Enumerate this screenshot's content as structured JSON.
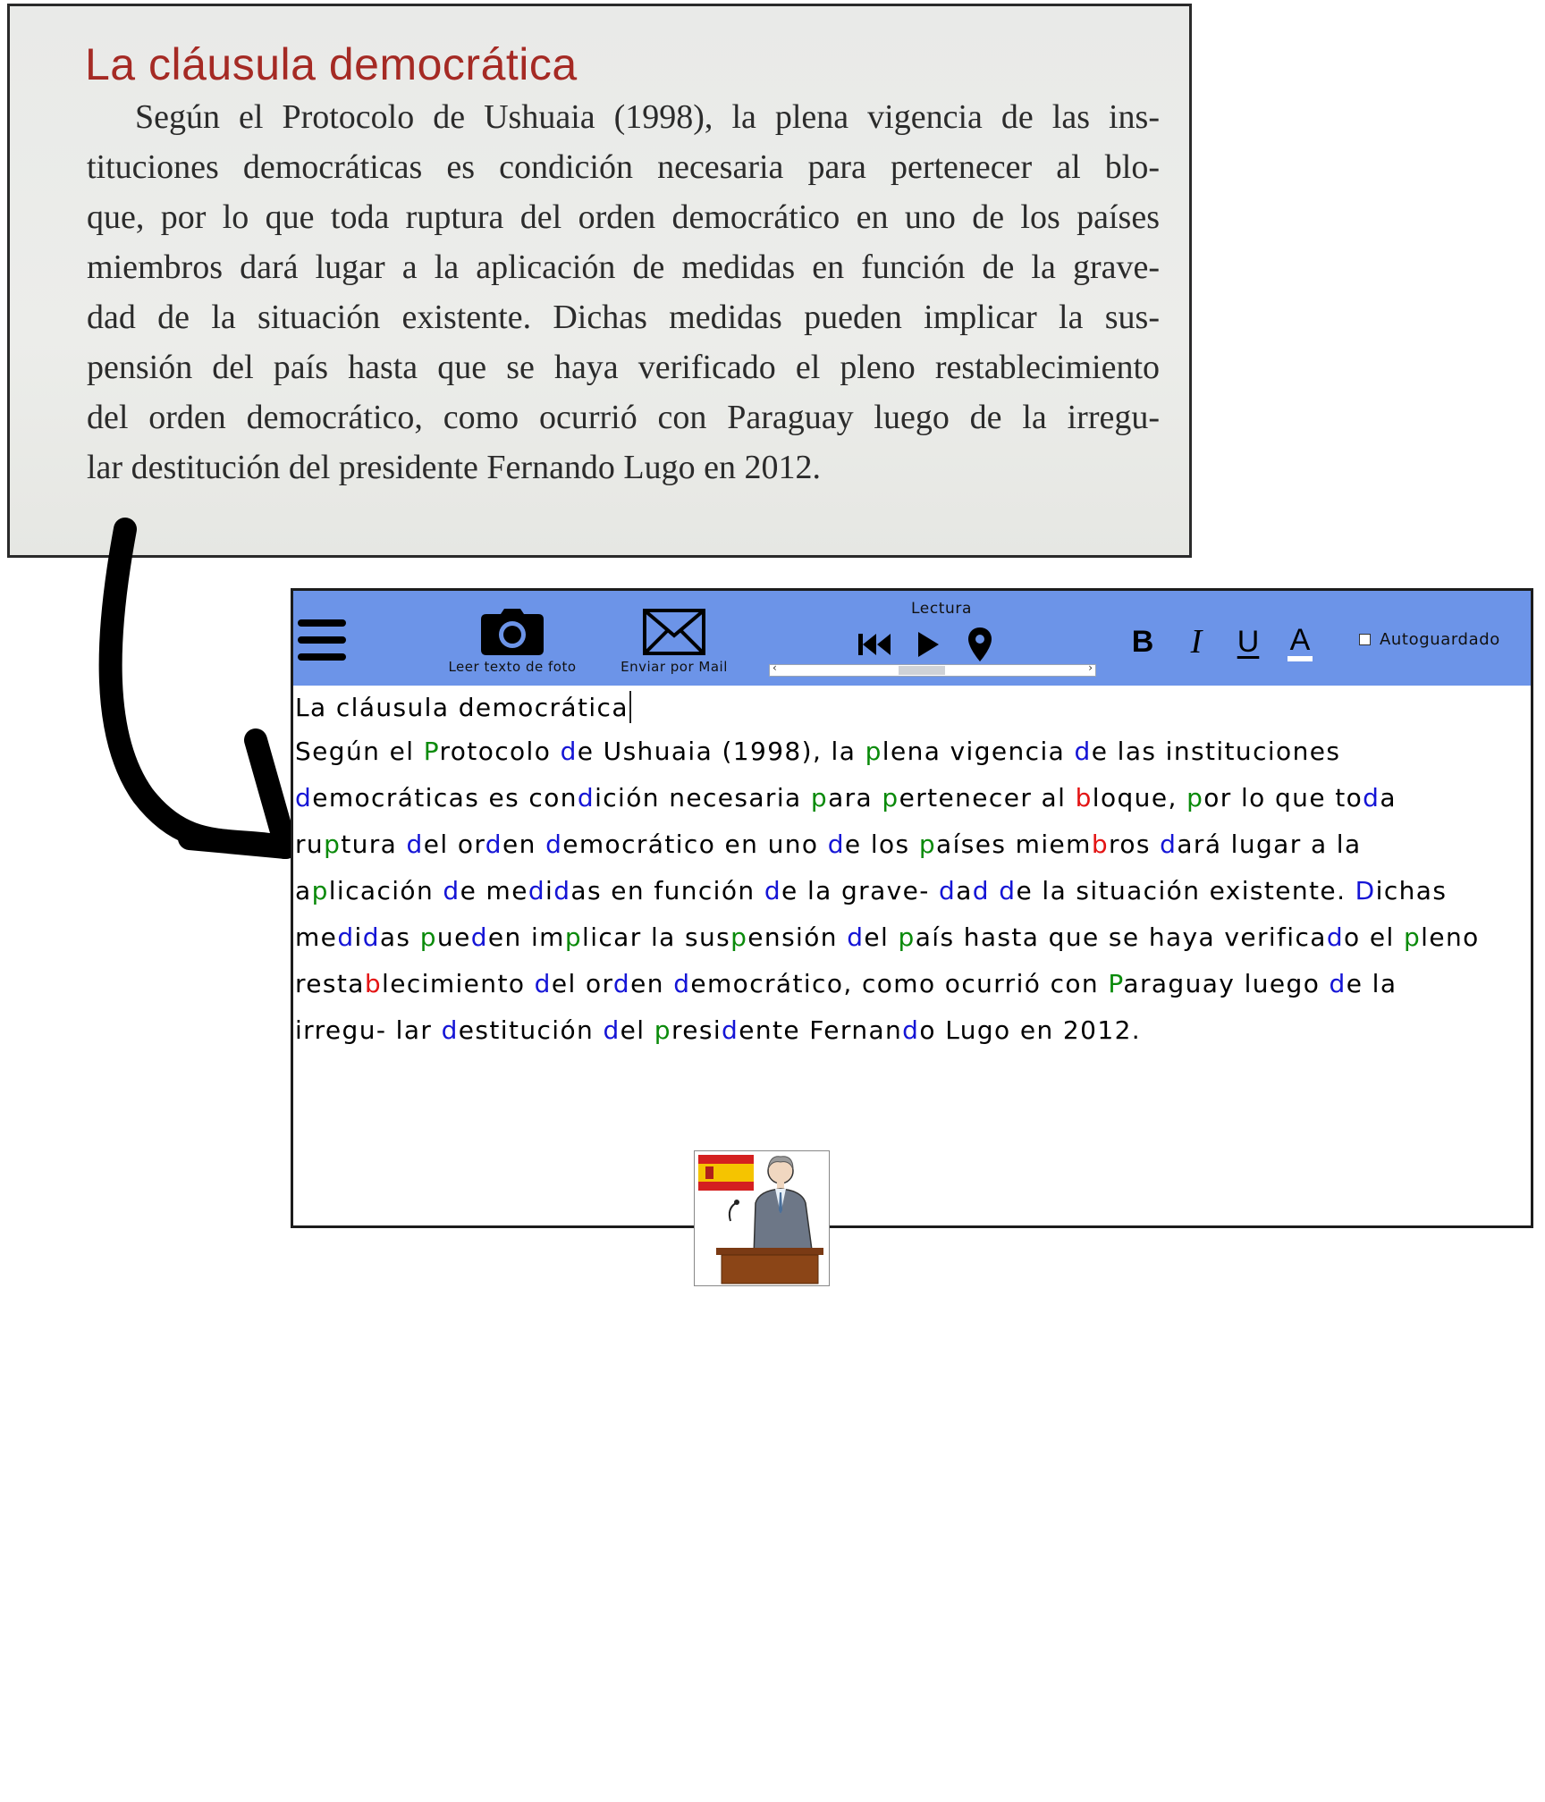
{
  "photo": {
    "title": "La cláusula democrática",
    "lines": [
      "Según el Protocolo de Ushuaia (1998), la plena vigencia de las ins-",
      "tituciones democráticas es condición necesaria para pertenecer al blo-",
      "que, por lo que toda ruptura del orden democrático en uno de los países",
      "miembros dará lugar a la aplicación de medidas en función de la grave-",
      "dad de la situación existente. Dichas medidas pueden implicar la sus-",
      "pensión del país hasta que se haya verificado el pleno restablecimiento",
      "del orden democrático, como ocurrió con Paraguay luego de la irregu-",
      "lar destitución del presidente Fernando Lugo en 2012."
    ]
  },
  "toolbar": {
    "menu_icon": "hamburger-menu-icon",
    "camera_icon": "camera-icon",
    "camera_label": "Leer texto de foto",
    "mail_icon": "envelope-icon",
    "mail_label": "Enviar por Mail",
    "reading_label": "Lectura",
    "rewind_icon": "skip-back-icon",
    "play_icon": "play-icon",
    "pin_icon": "map-pin-icon",
    "bold_label": "B",
    "italic_label": "I",
    "underline_label": "U",
    "font_color_label": "A",
    "autosave_label": "Autoguardado",
    "autosave_checked": false,
    "scroll_left": "‹",
    "scroll_right": "›",
    "background_color": "#6c94e8"
  },
  "editor": {
    "title": "La cláusula democrática",
    "color_codes": {
      "green": "#0a8a0a",
      "blue": "#1515d6",
      "red": "#e31414"
    },
    "lines": [
      [
        [
          "Según el ",
          ""
        ],
        [
          "P",
          "g"
        ],
        [
          "rotocolo ",
          ""
        ],
        [
          "d",
          "bl"
        ],
        [
          "e Ushuaia (1998), la ",
          ""
        ],
        [
          "p",
          "g"
        ],
        [
          "lena vigencia ",
          ""
        ],
        [
          "d",
          "bl"
        ],
        [
          "e las instituciones",
          ""
        ]
      ],
      [
        [
          "d",
          "bl"
        ],
        [
          "emocráticas es con",
          ""
        ],
        [
          "d",
          "bl"
        ],
        [
          "ición necesaria ",
          ""
        ],
        [
          "p",
          "g"
        ],
        [
          "ara ",
          ""
        ],
        [
          "p",
          "g"
        ],
        [
          "ertenecer al ",
          ""
        ],
        [
          "b",
          "r"
        ],
        [
          "loque, ",
          ""
        ],
        [
          "p",
          "g"
        ],
        [
          "or lo que to",
          ""
        ],
        [
          "d",
          "bl"
        ],
        [
          "a",
          ""
        ]
      ],
      [
        [
          "ru",
          ""
        ],
        [
          "p",
          "g"
        ],
        [
          "tura ",
          ""
        ],
        [
          "d",
          "bl"
        ],
        [
          "el or",
          ""
        ],
        [
          "d",
          "bl"
        ],
        [
          "en ",
          ""
        ],
        [
          "d",
          "bl"
        ],
        [
          "emocrático en uno ",
          ""
        ],
        [
          "d",
          "bl"
        ],
        [
          "e los ",
          ""
        ],
        [
          "p",
          "g"
        ],
        [
          "aíses miem",
          ""
        ],
        [
          "b",
          "r"
        ],
        [
          "ros ",
          ""
        ],
        [
          "d",
          "bl"
        ],
        [
          "ará lugar a la",
          ""
        ]
      ],
      [
        [
          "a",
          ""
        ],
        [
          "p",
          "g"
        ],
        [
          "licación ",
          ""
        ],
        [
          "d",
          "bl"
        ],
        [
          "e me",
          ""
        ],
        [
          "d",
          "bl"
        ],
        [
          "i",
          ""
        ],
        [
          "d",
          "bl"
        ],
        [
          "as en función ",
          ""
        ],
        [
          "d",
          "bl"
        ],
        [
          "e la grave- ",
          ""
        ],
        [
          "d",
          "bl"
        ],
        [
          "a",
          ""
        ],
        [
          "d",
          "bl"
        ],
        [
          " ",
          ""
        ],
        [
          "d",
          "bl"
        ],
        [
          "e la situación existente. ",
          ""
        ],
        [
          "D",
          "bl"
        ],
        [
          "ichas",
          ""
        ]
      ],
      [
        [
          "me",
          ""
        ],
        [
          "d",
          "bl"
        ],
        [
          "i",
          ""
        ],
        [
          "d",
          "bl"
        ],
        [
          "as ",
          ""
        ],
        [
          "p",
          "g"
        ],
        [
          "ue",
          ""
        ],
        [
          "d",
          "bl"
        ],
        [
          "en im",
          ""
        ],
        [
          "p",
          "g"
        ],
        [
          "licar la sus",
          ""
        ],
        [
          "p",
          "g"
        ],
        [
          "ensión ",
          ""
        ],
        [
          "d",
          "bl"
        ],
        [
          "el ",
          ""
        ],
        [
          "p",
          "g"
        ],
        [
          "aís hasta que se haya verifica",
          ""
        ],
        [
          "d",
          "bl"
        ],
        [
          "o el ",
          ""
        ],
        [
          "p",
          "g"
        ],
        [
          "leno",
          ""
        ]
      ],
      [
        [
          "resta",
          ""
        ],
        [
          "b",
          "r"
        ],
        [
          "lecimiento ",
          ""
        ],
        [
          "d",
          "bl"
        ],
        [
          "el or",
          ""
        ],
        [
          "d",
          "bl"
        ],
        [
          "en ",
          ""
        ],
        [
          "d",
          "bl"
        ],
        [
          "emocrático, como ocurrió con ",
          ""
        ],
        [
          "P",
          "g"
        ],
        [
          "araguay luego ",
          ""
        ],
        [
          "d",
          "bl"
        ],
        [
          "e la",
          ""
        ]
      ],
      [
        [
          "irregu- lar ",
          ""
        ],
        [
          "d",
          "bl"
        ],
        [
          "estitución ",
          ""
        ],
        [
          "d",
          "bl"
        ],
        [
          "el ",
          ""
        ],
        [
          "p",
          "g"
        ],
        [
          "resi",
          ""
        ],
        [
          "d",
          "bl"
        ],
        [
          "ente Fernan",
          ""
        ],
        [
          "d",
          "bl"
        ],
        [
          "o Lugo en 2012.",
          ""
        ]
      ]
    ],
    "pictogram": "spanish-president-at-podium-pictogram"
  }
}
